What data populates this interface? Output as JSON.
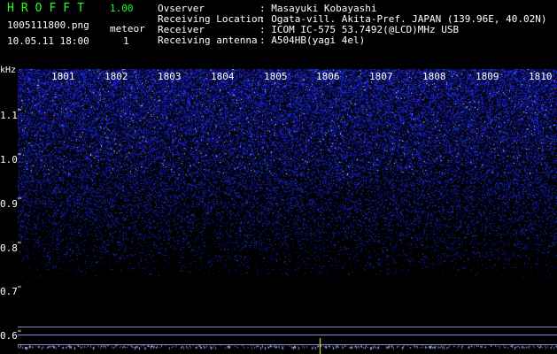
{
  "app": {
    "title": "HROFFT",
    "version": "1.00"
  },
  "file": {
    "name": "1005111800.png",
    "timestamp": "10.05.11 18:00"
  },
  "meteor": {
    "label": "meteor",
    "count": "1"
  },
  "info": [
    {
      "key": "Ovserver",
      "value": ": Masayuki Kobayashi"
    },
    {
      "key": "Receiving Location",
      "value": ": Ogata-vill. Akita-Pref. JAPAN (139.96E, 40.02N)"
    },
    {
      "key": "Receiver",
      "value": ": ICOM IC-575 53.7492(@LCD)MHz USB"
    },
    {
      "key": "Receiving antenna",
      "value": ": A504HB(yagi 4el)"
    }
  ],
  "axis": {
    "unit": "kHz",
    "time_ticks": [
      "1801",
      "1802",
      "1803",
      "1804",
      "1805",
      "1806",
      "1807",
      "1808",
      "1809",
      "1810"
    ],
    "freq_ticks": [
      "1.1",
      "1.0",
      "0.9",
      "0.8",
      "0.7",
      "0.6"
    ]
  },
  "colors": {
    "accent": "#22ff22",
    "signal": "#3a4cff",
    "background": "#000000"
  }
}
